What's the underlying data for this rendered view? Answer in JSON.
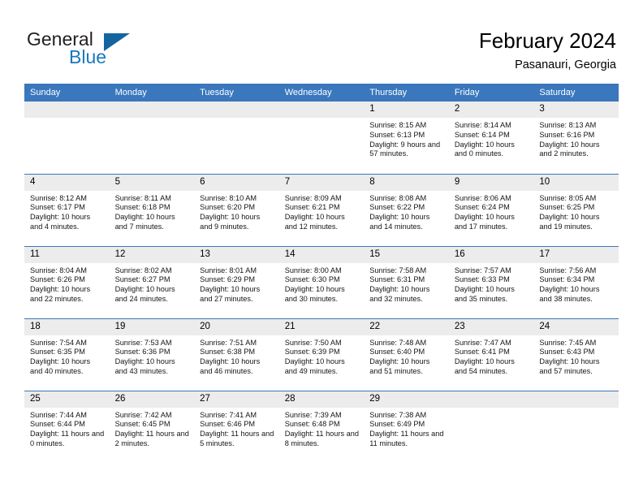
{
  "logo": {
    "word1": "General",
    "word2": "Blue",
    "triangle_color": "#14659e",
    "blue_color": "#1878be"
  },
  "header": {
    "title": "February 2024",
    "subtitle": "Pasanauri, Georgia"
  },
  "theme": {
    "header_bg": "#3a77bd",
    "daynum_bg": "#ececec",
    "separator": "#3a77bd"
  },
  "weekdays": [
    "Sunday",
    "Monday",
    "Tuesday",
    "Wednesday",
    "Thursday",
    "Friday",
    "Saturday"
  ],
  "weeks": [
    [
      {
        "day": "",
        "blank": true
      },
      {
        "day": "",
        "blank": true
      },
      {
        "day": "",
        "blank": true
      },
      {
        "day": "",
        "blank": true
      },
      {
        "day": "1",
        "sunrise": "Sunrise: 8:15 AM",
        "sunset": "Sunset: 6:13 PM",
        "daylight": "Daylight: 9 hours and 57 minutes."
      },
      {
        "day": "2",
        "sunrise": "Sunrise: 8:14 AM",
        "sunset": "Sunset: 6:14 PM",
        "daylight": "Daylight: 10 hours and 0 minutes."
      },
      {
        "day": "3",
        "sunrise": "Sunrise: 8:13 AM",
        "sunset": "Sunset: 6:16 PM",
        "daylight": "Daylight: 10 hours and 2 minutes."
      }
    ],
    [
      {
        "day": "4",
        "sunrise": "Sunrise: 8:12 AM",
        "sunset": "Sunset: 6:17 PM",
        "daylight": "Daylight: 10 hours and 4 minutes."
      },
      {
        "day": "5",
        "sunrise": "Sunrise: 8:11 AM",
        "sunset": "Sunset: 6:18 PM",
        "daylight": "Daylight: 10 hours and 7 minutes."
      },
      {
        "day": "6",
        "sunrise": "Sunrise: 8:10 AM",
        "sunset": "Sunset: 6:20 PM",
        "daylight": "Daylight: 10 hours and 9 minutes."
      },
      {
        "day": "7",
        "sunrise": "Sunrise: 8:09 AM",
        "sunset": "Sunset: 6:21 PM",
        "daylight": "Daylight: 10 hours and 12 minutes."
      },
      {
        "day": "8",
        "sunrise": "Sunrise: 8:08 AM",
        "sunset": "Sunset: 6:22 PM",
        "daylight": "Daylight: 10 hours and 14 minutes."
      },
      {
        "day": "9",
        "sunrise": "Sunrise: 8:06 AM",
        "sunset": "Sunset: 6:24 PM",
        "daylight": "Daylight: 10 hours and 17 minutes."
      },
      {
        "day": "10",
        "sunrise": "Sunrise: 8:05 AM",
        "sunset": "Sunset: 6:25 PM",
        "daylight": "Daylight: 10 hours and 19 minutes."
      }
    ],
    [
      {
        "day": "11",
        "sunrise": "Sunrise: 8:04 AM",
        "sunset": "Sunset: 6:26 PM",
        "daylight": "Daylight: 10 hours and 22 minutes."
      },
      {
        "day": "12",
        "sunrise": "Sunrise: 8:02 AM",
        "sunset": "Sunset: 6:27 PM",
        "daylight": "Daylight: 10 hours and 24 minutes."
      },
      {
        "day": "13",
        "sunrise": "Sunrise: 8:01 AM",
        "sunset": "Sunset: 6:29 PM",
        "daylight": "Daylight: 10 hours and 27 minutes."
      },
      {
        "day": "14",
        "sunrise": "Sunrise: 8:00 AM",
        "sunset": "Sunset: 6:30 PM",
        "daylight": "Daylight: 10 hours and 30 minutes."
      },
      {
        "day": "15",
        "sunrise": "Sunrise: 7:58 AM",
        "sunset": "Sunset: 6:31 PM",
        "daylight": "Daylight: 10 hours and 32 minutes."
      },
      {
        "day": "16",
        "sunrise": "Sunrise: 7:57 AM",
        "sunset": "Sunset: 6:33 PM",
        "daylight": "Daylight: 10 hours and 35 minutes."
      },
      {
        "day": "17",
        "sunrise": "Sunrise: 7:56 AM",
        "sunset": "Sunset: 6:34 PM",
        "daylight": "Daylight: 10 hours and 38 minutes."
      }
    ],
    [
      {
        "day": "18",
        "sunrise": "Sunrise: 7:54 AM",
        "sunset": "Sunset: 6:35 PM",
        "daylight": "Daylight: 10 hours and 40 minutes."
      },
      {
        "day": "19",
        "sunrise": "Sunrise: 7:53 AM",
        "sunset": "Sunset: 6:36 PM",
        "daylight": "Daylight: 10 hours and 43 minutes."
      },
      {
        "day": "20",
        "sunrise": "Sunrise: 7:51 AM",
        "sunset": "Sunset: 6:38 PM",
        "daylight": "Daylight: 10 hours and 46 minutes."
      },
      {
        "day": "21",
        "sunrise": "Sunrise: 7:50 AM",
        "sunset": "Sunset: 6:39 PM",
        "daylight": "Daylight: 10 hours and 49 minutes."
      },
      {
        "day": "22",
        "sunrise": "Sunrise: 7:48 AM",
        "sunset": "Sunset: 6:40 PM",
        "daylight": "Daylight: 10 hours and 51 minutes."
      },
      {
        "day": "23",
        "sunrise": "Sunrise: 7:47 AM",
        "sunset": "Sunset: 6:41 PM",
        "daylight": "Daylight: 10 hours and 54 minutes."
      },
      {
        "day": "24",
        "sunrise": "Sunrise: 7:45 AM",
        "sunset": "Sunset: 6:43 PM",
        "daylight": "Daylight: 10 hours and 57 minutes."
      }
    ],
    [
      {
        "day": "25",
        "sunrise": "Sunrise: 7:44 AM",
        "sunset": "Sunset: 6:44 PM",
        "daylight": "Daylight: 11 hours and 0 minutes."
      },
      {
        "day": "26",
        "sunrise": "Sunrise: 7:42 AM",
        "sunset": "Sunset: 6:45 PM",
        "daylight": "Daylight: 11 hours and 2 minutes."
      },
      {
        "day": "27",
        "sunrise": "Sunrise: 7:41 AM",
        "sunset": "Sunset: 6:46 PM",
        "daylight": "Daylight: 11 hours and 5 minutes."
      },
      {
        "day": "28",
        "sunrise": "Sunrise: 7:39 AM",
        "sunset": "Sunset: 6:48 PM",
        "daylight": "Daylight: 11 hours and 8 minutes."
      },
      {
        "day": "29",
        "sunrise": "Sunrise: 7:38 AM",
        "sunset": "Sunset: 6:49 PM",
        "daylight": "Daylight: 11 hours and 11 minutes."
      },
      {
        "day": "",
        "blank": true
      },
      {
        "day": "",
        "blank": true
      }
    ]
  ]
}
